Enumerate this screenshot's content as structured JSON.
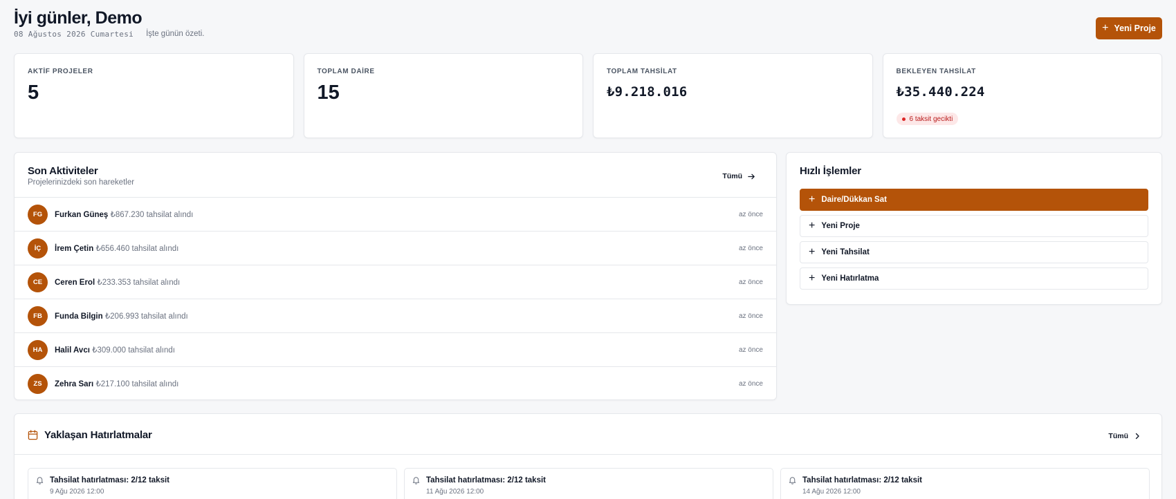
{
  "header": {
    "greeting": "İyi günler, Demo",
    "date": "08 Ağustos 2026 Cumartesi",
    "summary": "İşte günün özeti.",
    "new_project_label": "Yeni Proje"
  },
  "stats": [
    {
      "label": "AKTİF PROJELER",
      "value": "5"
    },
    {
      "label": "TOPLAM DAİRE",
      "value": "15"
    },
    {
      "label": "TOPLAM TAHSİLAT",
      "value": "₺9.218.016"
    },
    {
      "label": "BEKLEYEN TAHSİLAT",
      "value": "₺35.440.224",
      "badge": "6 taksit gecikti"
    }
  ],
  "activities": {
    "title": "Son Aktiviteler",
    "subtitle": "Projelerinizdeki son hareketler",
    "all_label": "Tümü",
    "items": [
      {
        "initials": "FG",
        "name": "Furkan Güneş",
        "detail": "₺867.230 tahsilat alındı",
        "time": "az önce"
      },
      {
        "initials": "İÇ",
        "name": "İrem Çetin",
        "detail": "₺656.460 tahsilat alındı",
        "time": "az önce"
      },
      {
        "initials": "CE",
        "name": "Ceren Erol",
        "detail": "₺233.353 tahsilat alındı",
        "time": "az önce"
      },
      {
        "initials": "FB",
        "name": "Funda Bilgin",
        "detail": "₺206.993 tahsilat alındı",
        "time": "az önce"
      },
      {
        "initials": "HA",
        "name": "Halil Avcı",
        "detail": "₺309.000 tahsilat alındı",
        "time": "az önce"
      },
      {
        "initials": "ZS",
        "name": "Zehra Sarı",
        "detail": "₺217.100 tahsilat alındı",
        "time": "az önce"
      }
    ]
  },
  "quick_actions": {
    "title": "Hızlı İşlemler",
    "items": [
      {
        "label": "Daire/Dükkan Sat"
      },
      {
        "label": "Yeni Proje"
      },
      {
        "label": "Yeni Tahsilat"
      },
      {
        "label": "Yeni Hatırlatma"
      }
    ]
  },
  "reminders": {
    "title": "Yaklaşan Hatırlatmalar",
    "all_label": "Tümü",
    "items": [
      {
        "title": "Tahsilat hatırlatması: 2/12 taksit",
        "date": "9 Ağu 2026 12:00"
      },
      {
        "title": "Tahsilat hatırlatması: 2/12 taksit",
        "date": "11 Ağu 2026 12:00"
      },
      {
        "title": "Tahsilat hatırlatması: 2/12 taksit",
        "date": "14 Ağu 2026 12:00"
      }
    ]
  },
  "colors": {
    "accent": "#b45309",
    "danger": "#dc2626",
    "badge_bg": "#fde8e8"
  }
}
